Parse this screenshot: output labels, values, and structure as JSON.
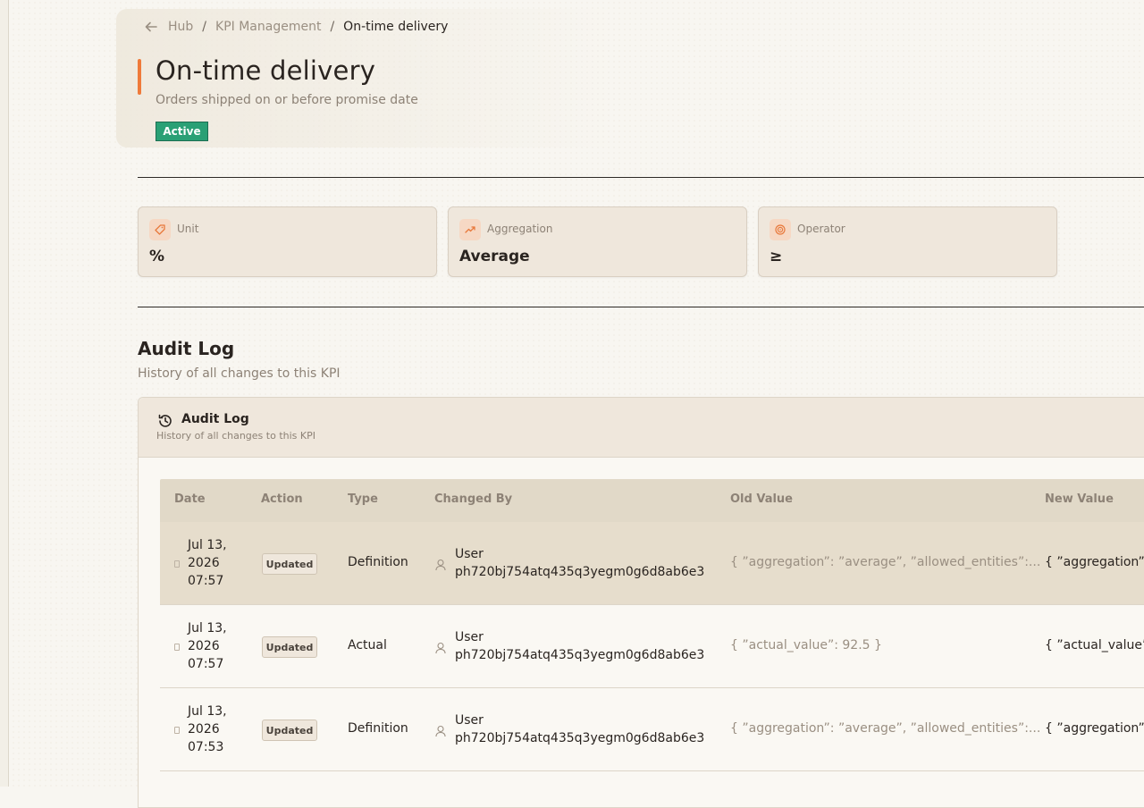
{
  "breadcrumb": {
    "items": [
      "Hub",
      "KPI Management",
      "On-time delivery"
    ],
    "separator": "/"
  },
  "kpi": {
    "title": "On-time delivery",
    "subtitle": "Orders shipped on or before promise date",
    "status": "Active",
    "accent_color": "#ef7a3a",
    "status_color": "#2aa075"
  },
  "stats": [
    {
      "label": "Unit",
      "value": "%",
      "icon": "tag-icon"
    },
    {
      "label": "Aggregation",
      "value": "Average",
      "icon": "trending-up-icon"
    },
    {
      "label": "Operator",
      "value": "≥",
      "icon": "target-icon"
    }
  ],
  "audit_section": {
    "title": "Audit Log",
    "subtitle": "History of all changes to this KPI"
  },
  "audit_panel": {
    "title": "Audit Log",
    "subtitle": "History of all changes to this KPI",
    "icon": "history-icon"
  },
  "table": {
    "columns": [
      "Date",
      "Action",
      "Type",
      "Changed By",
      "Old Value",
      "New Value"
    ],
    "rows": [
      {
        "date": "Jul 13,\n2026\n07:57",
        "action": "Updated",
        "type": "Definition",
        "changed_by": "User\nph720bj754atq435q3yegm0g6d8ab6e3",
        "old_value": "{ ”aggregation”: ”average”, ”allowed_entities”:...",
        "new_value": "{ ”aggregation”: "
      },
      {
        "date": "Jul 13,\n2026\n07:57",
        "action": "Updated",
        "type": "Actual",
        "changed_by": "User\nph720bj754atq435q3yegm0g6d8ab6e3",
        "old_value": "{ ”actual_value”: 92.5 }",
        "new_value": "{ ”actual_value”: "
      },
      {
        "date": "Jul 13,\n2026\n07:53",
        "action": "Updated",
        "type": "Definition",
        "changed_by": "User\nph720bj754atq435q3yegm0g6d8ab6e3",
        "old_value": "{ ”aggregation”: ”average”, ”allowed_entities”:...",
        "new_value": "{ ”aggregation”: "
      }
    ]
  }
}
